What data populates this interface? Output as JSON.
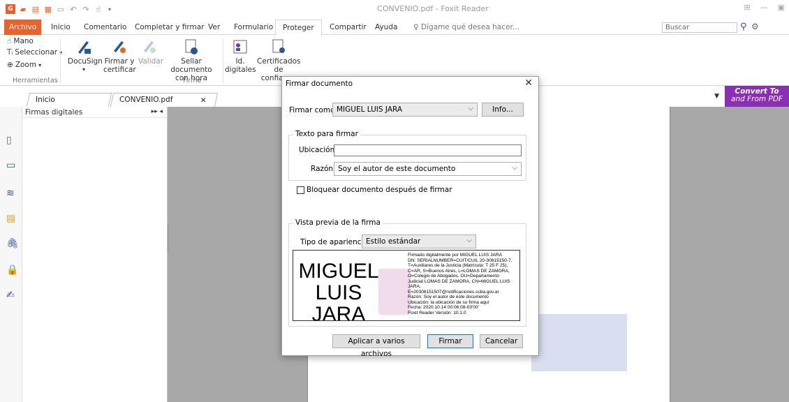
{
  "window": {
    "title": "CONVENIO.pdf - Foxit Reader",
    "app_logo": "G"
  },
  "ribbon_tabs": [
    {
      "label": "Archivo"
    },
    {
      "label": "Inicio"
    },
    {
      "label": "Comentario"
    },
    {
      "label": "Completar y firmar"
    },
    {
      "label": "Ver"
    },
    {
      "label": "Formulario"
    },
    {
      "label": "Proteger"
    },
    {
      "label": "Compartir"
    },
    {
      "label": "Ayuda"
    },
    {
      "label": "Dígame qué desea hacer..."
    }
  ],
  "search": {
    "placeholder": "Buscar"
  },
  "ribbon": {
    "tools": {
      "hand": "Mano",
      "select": "Seleccionar",
      "zoom": "Zoom",
      "group_label": "Herramientas"
    },
    "buttons": {
      "docusign": "DocuSign",
      "sign_certify_1": "Firmar y",
      "sign_certify_2": "certificar",
      "validate": "Validar",
      "timestamp_1": "Sellar documento",
      "timestamp_2": "con hora",
      "digital_ids_1": "Id.",
      "digital_ids_2": "digitales",
      "trusted_certs_1": "Certificados",
      "trusted_certs_2": "de confianza",
      "group_label_sign": "Firma"
    }
  },
  "doc_tabs": [
    {
      "label": "Inicio"
    },
    {
      "label": "CONVENIO.pdf"
    }
  ],
  "convert_banner": {
    "line1": "Convert To",
    "line2": "and From PDF"
  },
  "sig_panel": {
    "title": "Firmas digitales"
  },
  "dialog": {
    "title": "Firmar documento",
    "sign_as_label": "Firmar como:",
    "sign_as_value": "MIGUEL LUIS JARA",
    "info_button": "Info...",
    "text_section": "Texto para firmar",
    "location_label": "Ubicación:",
    "location_value": "",
    "reason_label": "Razón:",
    "reason_value": "Soy el autor de este documento",
    "lock_label": "Bloquear documento después de firmar",
    "lock_checked": false,
    "preview_section": "Vista previa de la firma",
    "appearance_label": "Tipo de apariencia:",
    "appearance_value": "Estilo estándar",
    "preview": {
      "name_line1": "MIGUEL",
      "name_line2": "LUIS JARA",
      "details": [
        "Firmado digitalmente por MIGUEL LUIS JARA",
        "DN: SERIALNUMBER=CUIT/CUIL 20-30815150-7,",
        "T=Auxiliares de la Justicia (Matrícula: T 25 F 25),",
        "C=AR, S=Buenos Aires, L=LOMAS DE ZAMORA,",
        "O=Colegio de Abogados, OU=Departamento",
        "Judicial LOMAS DE ZAMORA, CN=MIGUEL LUIS",
        "JARA,",
        "E=20308151507@notificaciones.scba.gov.ar",
        "Razón: Soy el autor de este documento",
        "Ubicación: la ubicación de su firma aquí",
        "Fecha: 2020.10.14 00:06:08-03'00'",
        "Foxit Reader Versión: 10.1.0"
      ]
    },
    "apply_button": "Aplicar a varios archivos",
    "sign_button": "Firmar",
    "cancel_button": "Cancelar"
  },
  "colors": {
    "accent": "#e8632b",
    "convert_banner": "#8a2fb5",
    "sig_field": "#d9dff0"
  }
}
